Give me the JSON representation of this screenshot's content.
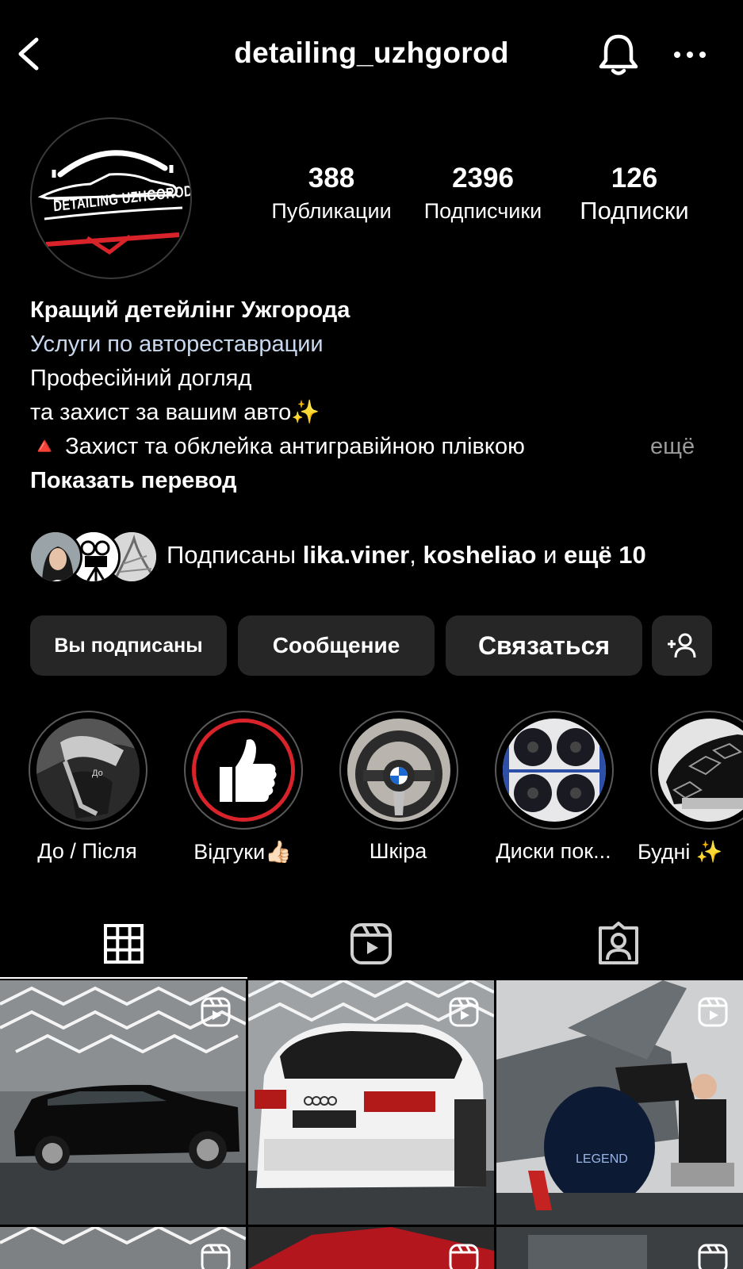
{
  "header": {
    "username": "detailing_uzhgorod"
  },
  "profile": {
    "logo_text": "DETAILING UZHGOROD",
    "stats": [
      {
        "value": "388",
        "label": "Публикации"
      },
      {
        "value": "2396",
        "label": "Подписчики"
      },
      {
        "value": "126",
        "label": "Подписки"
      }
    ]
  },
  "bio": {
    "name": "Кращий детейлінг Ужгорода",
    "category": "Услуги по автореставрации",
    "lines": [
      "Професійний догляд",
      "та захист за вашим авто✨",
      "🔺 Захист та обклейка антигравійною плівкою"
    ],
    "more": "ещё",
    "translate": "Показать перевод"
  },
  "followed_by": {
    "prefix": "Подписаны ",
    "user1": "lika.viner",
    "sep": ", ",
    "user2": "kosheliao",
    "and": " и ",
    "rest": "ещё 10"
  },
  "buttons": {
    "following": "Вы подписаны",
    "message": "Сообщение",
    "contact": "Связаться"
  },
  "highlights": [
    {
      "label": "До / Після",
      "icon": "steering-wheel-image"
    },
    {
      "label": "Відгуки👍🏻",
      "icon": "thumbs-up-image"
    },
    {
      "label": "Шкіра",
      "icon": "bmw-steering-image"
    },
    {
      "label": "Диски пок...",
      "icon": "wheel-rims-image"
    },
    {
      "label": "Будні ✨",
      "icon": "car-hood-image"
    }
  ],
  "tabs": [
    "posts-grid",
    "reels",
    "tagged"
  ],
  "colors": {
    "background": "#000000",
    "button_bg": "#262626",
    "category_text": "#c8d8ef",
    "muted": "#9a9a9a",
    "brand_red": "#d8232a"
  }
}
